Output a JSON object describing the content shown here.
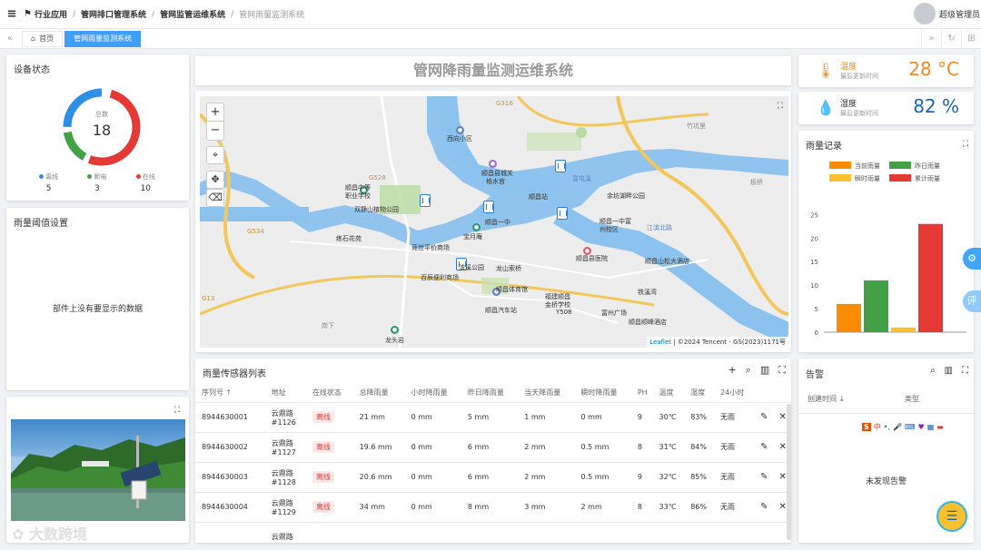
{
  "breadcrumb": {
    "items": [
      "行业应用",
      "管网排口管理系统",
      "管网监管运维系统"
    ],
    "current": "管网雨量监测系统"
  },
  "user": {
    "name": "超级管理员"
  },
  "tabs": {
    "home": "首页",
    "active": "管网雨量监测系统"
  },
  "device_status": {
    "title": "设备状态",
    "center_label": "总数",
    "total": "18",
    "legend": [
      {
        "label": "离线",
        "value": "5",
        "color": "#2f8ee6"
      },
      {
        "label": "断电",
        "value": "3",
        "color": "#43a047"
      },
      {
        "label": "在线",
        "value": "10",
        "color": "#e53935"
      }
    ]
  },
  "threshold": {
    "title": "雨量阈值设置",
    "empty": "部件上没有要显示的数据"
  },
  "header": {
    "title": "管网降雨量监测运维系统"
  },
  "map": {
    "attribution_leaflet": "Leaflet",
    "attribution_rest": "| ©2024 Tencent - GS(2023)1171号",
    "labels": {
      "l1": "西向小区",
      "l2": "顺昌县城关",
      "l3": "格水宫",
      "l4": "顺昌中等",
      "l5": "职业学校",
      "l6": "双静山植物公园",
      "l7": "顺昌站",
      "l8": "顺昌一中",
      "l9": "宝月庵",
      "l10": "余坊湖畔公园",
      "l11": "顺昌一中富",
      "l12": "州校区",
      "l13": "练石花苑",
      "l14": "竞世平价商场",
      "l15": "百辰便利商场",
      "l16": "滨溪公园",
      "l17": "龙山索桥",
      "l18": "顺昌县医院",
      "l19": "顺昌山松大酒店",
      "l20": "顺昌体育馆",
      "l21": "福建顺昌",
      "l22": "金桥学校",
      "l23": "顺昌汽车站",
      "l24": "富州广场",
      "l25": "顺昌顺峰酒店",
      "l26": "龙头岩",
      "l27": "铁溪湾",
      "l28": "竹坑里",
      "l29": "板桥",
      "l30": "岗下",
      "l31": "G316",
      "l32": "G528",
      "l33": "G534",
      "l34": "G13",
      "l35": "Y508",
      "l36": "江滨北路",
      "l37": "富屯溪"
    }
  },
  "sensor_table": {
    "title": "雨量传感器列表",
    "columns": [
      "序列号",
      "地址",
      "在线状态",
      "总降雨量",
      "小时降雨量",
      "昨日降雨量",
      "当天降雨量",
      "瞬时降雨量",
      "PH",
      "温度",
      "湿度",
      "24小时"
    ],
    "rows": [
      {
        "sn": "8944630001",
        "addr1": "云鼎路",
        "addr2": "#1126",
        "status": "离线",
        "total": "21 mm",
        "hour": "0 mm",
        "yesterday": "5 mm",
        "today": "1 mm",
        "instant": "0 mm",
        "ph": "9",
        "temp": "30℃",
        "hum": "83%",
        "h24": "无雨"
      },
      {
        "sn": "8944630002",
        "addr1": "云鼎路",
        "addr2": "#1127",
        "status": "离线",
        "total": "19.6 mm",
        "hour": "0 mm",
        "yesterday": "6 mm",
        "today": "2 mm",
        "instant": "0.5 mm",
        "ph": "8",
        "temp": "31℃",
        "hum": "84%",
        "h24": "无雨"
      },
      {
        "sn": "8944630003",
        "addr1": "云鼎路",
        "addr2": "#1128",
        "status": "离线",
        "total": "20.6 mm",
        "hour": "0 mm",
        "yesterday": "6 mm",
        "today": "2 mm",
        "instant": "0.5 mm",
        "ph": "9",
        "temp": "32℃",
        "hum": "85%",
        "h24": "无雨"
      },
      {
        "sn": "8944630004",
        "addr1": "云鼎路",
        "addr2": "#1129",
        "status": "离线",
        "total": "34 mm",
        "hour": "0 mm",
        "yesterday": "8 mm",
        "today": "3 mm",
        "instant": "2 mm",
        "ph": "8",
        "temp": "33℃",
        "hum": "86%",
        "h24": "无雨"
      }
    ],
    "partial_row": "云鼎路"
  },
  "temperature": {
    "label": "温度",
    "sub": "最后更新时间",
    "value": "28 °C",
    "color": "#f08a24"
  },
  "humidity": {
    "label": "湿度",
    "sub": "最后更新时间",
    "value": "82 %",
    "color": "#1565c0"
  },
  "rain_record": {
    "title": "雨量记录"
  },
  "chart_data": {
    "type": "bar",
    "categories": [
      ""
    ],
    "series": [
      {
        "name": "当前雨量",
        "values": [
          6
        ],
        "color": "#fb8c00"
      },
      {
        "name": "昨日雨量",
        "values": [
          11
        ],
        "color": "#43a047"
      },
      {
        "name": "瞬时雨量",
        "values": [
          1
        ],
        "color": "#fbc02d"
      },
      {
        "name": "累计雨量",
        "values": [
          23
        ],
        "color": "#e53935"
      }
    ],
    "yticks": [
      "0",
      "5",
      "10",
      "15",
      "20",
      "25"
    ],
    "ylim": [
      0,
      27
    ],
    "legend_placement": "top"
  },
  "alarm": {
    "title": "告警",
    "col_time": "创建时间",
    "col_type": "类型",
    "empty": "未发现告警"
  },
  "floating": {
    "settings": "⚙",
    "comment": "评"
  },
  "watermark": "大数跨境"
}
